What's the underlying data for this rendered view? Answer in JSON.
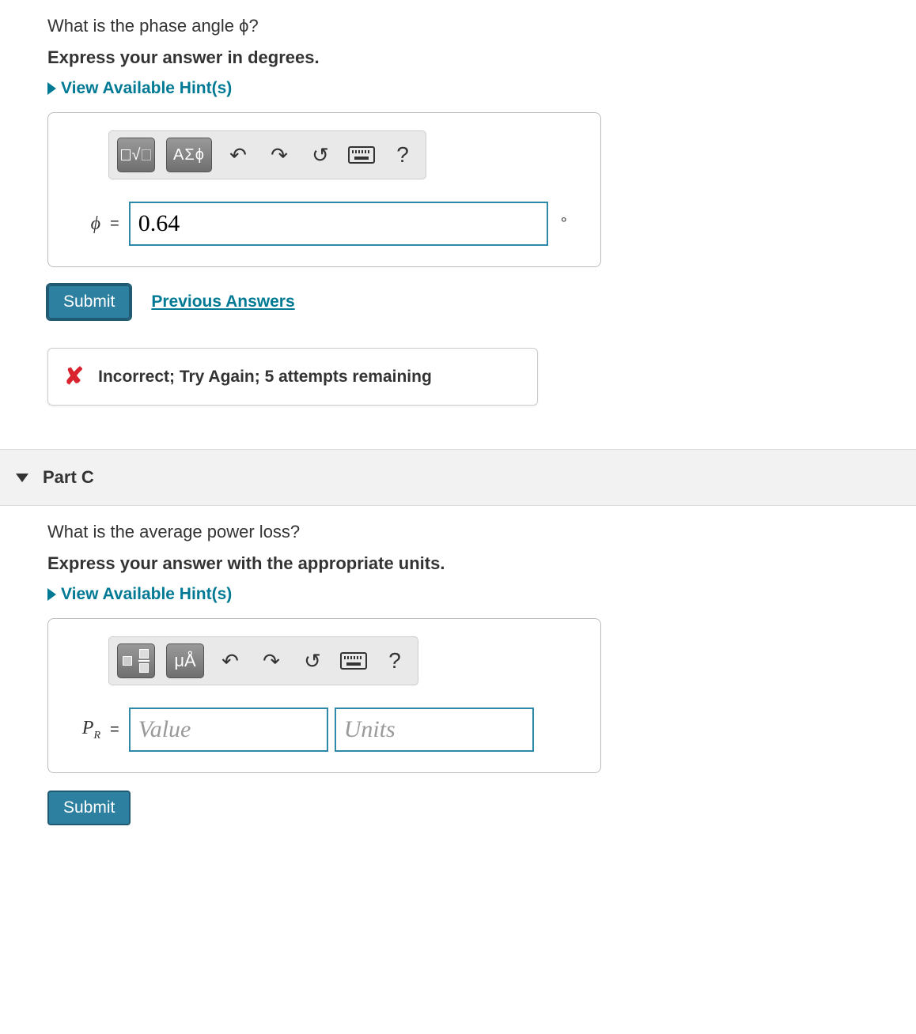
{
  "partB": {
    "question": "What is the phase angle ϕ?",
    "instruction": "Express your answer in degrees.",
    "hintsLabel": "View Available Hint(s)",
    "toolbar": {
      "mathTemplates": "math-templates",
      "greekLabel": "ΑΣϕ",
      "undo": "undo",
      "redo": "redo",
      "reset": "reset",
      "keyboard": "keyboard",
      "help": "?"
    },
    "varLabel": "ϕ",
    "eq": "=",
    "value": "0.64",
    "unitSymbol": "°",
    "submitLabel": "Submit",
    "prevAnswersLabel": "Previous Answers",
    "feedback": "Incorrect; Try Again; 5 attempts remaining"
  },
  "partC": {
    "header": "Part C",
    "question": "What is the average power loss?",
    "instruction": "Express your answer with the appropriate units.",
    "hintsLabel": "View Available Hint(s)",
    "toolbar": {
      "templates": "unit-templates",
      "unitsLabel": "μÅ",
      "undo": "undo",
      "redo": "redo",
      "reset": "reset",
      "keyboard": "keyboard",
      "help": "?"
    },
    "varHtmlPrefix": "P",
    "varSub": "R",
    "eq": "=",
    "valuePlaceholder": "Value",
    "unitsPlaceholder": "Units",
    "submitLabel": "Submit"
  }
}
